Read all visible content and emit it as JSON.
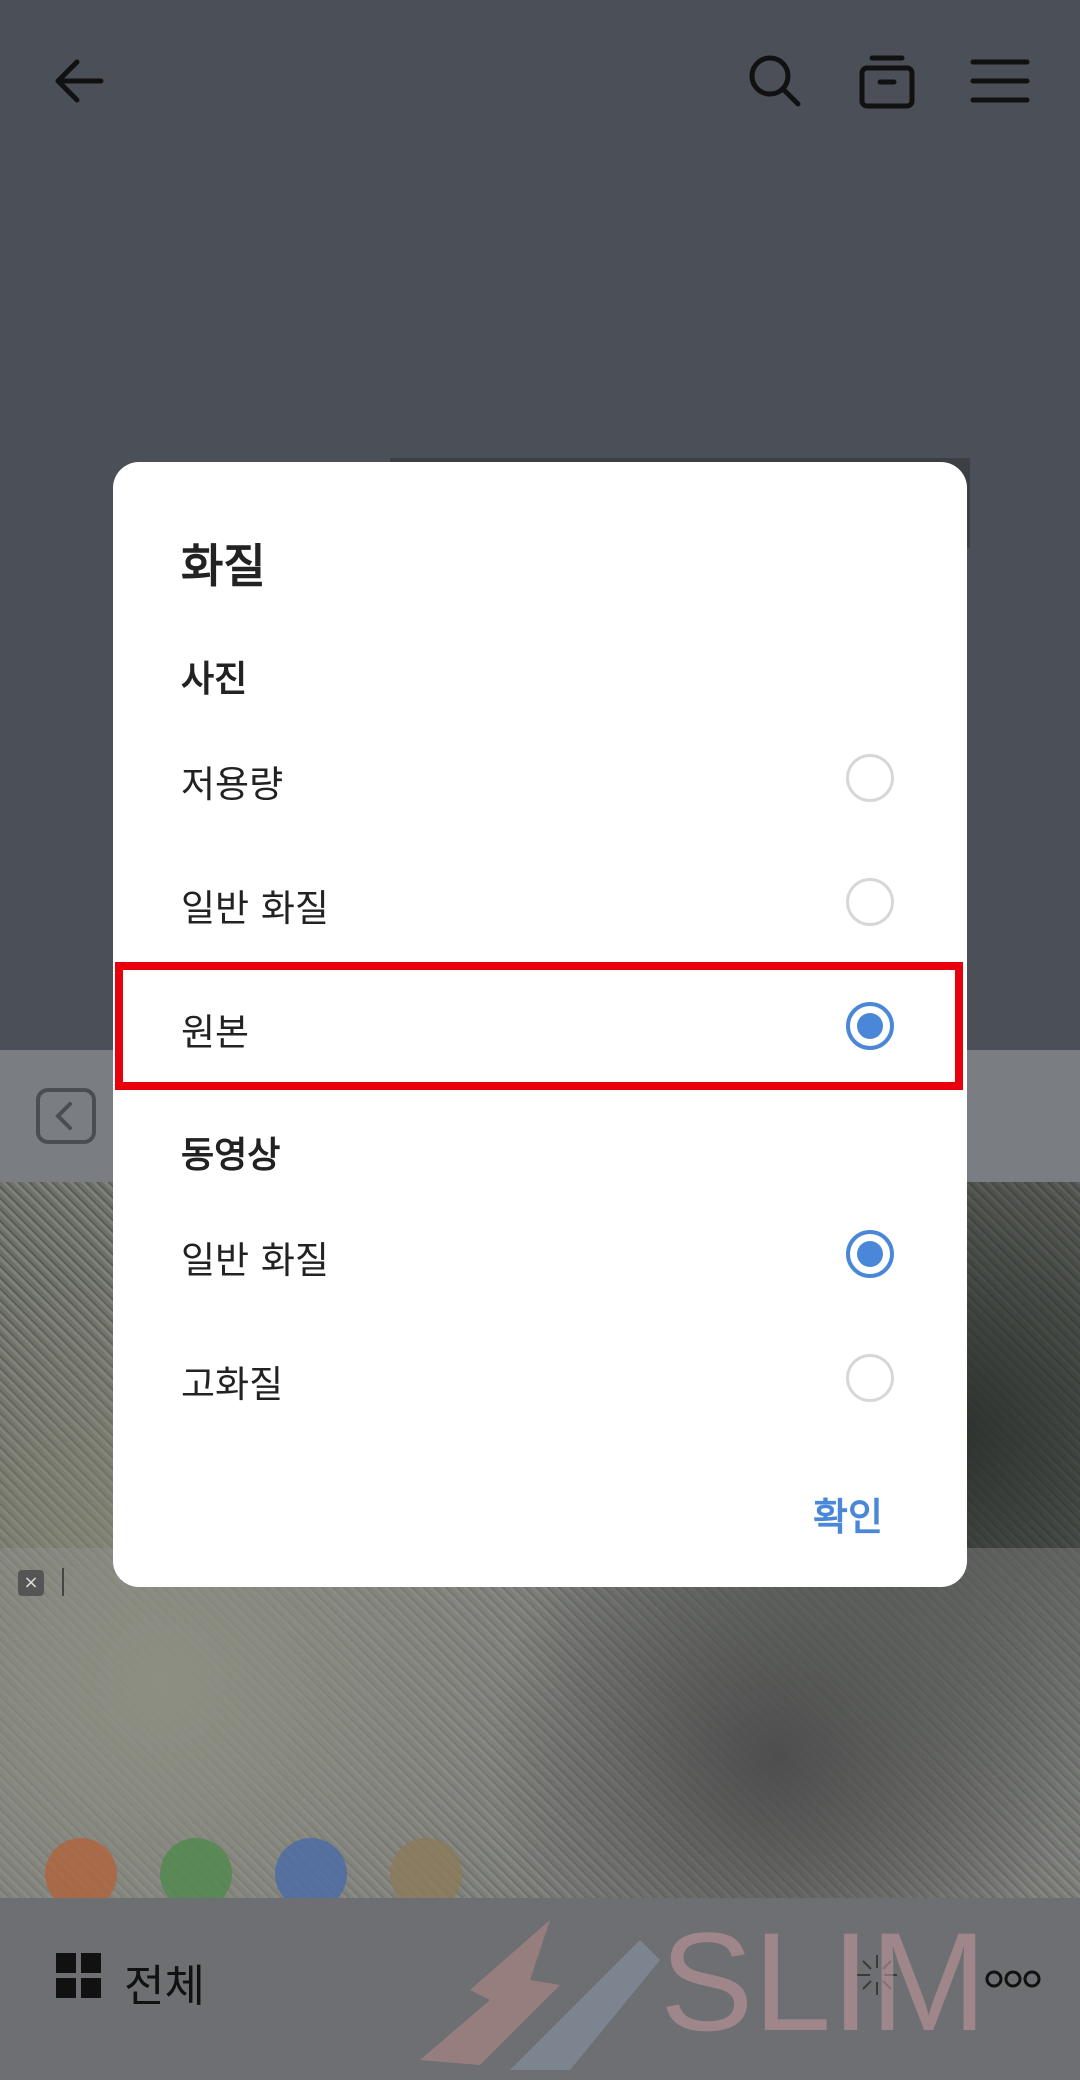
{
  "dialog": {
    "title": "화질",
    "photo_section": "사진",
    "photo_options": [
      {
        "label": "저용량",
        "selected": false
      },
      {
        "label": "일반 화질",
        "selected": false
      },
      {
        "label": "원본",
        "selected": true
      }
    ],
    "video_section": "동영상",
    "video_options": [
      {
        "label": "일반 화질",
        "selected": true
      },
      {
        "label": "고화질",
        "selected": false
      }
    ],
    "confirm": "확인"
  },
  "bottom_bar": {
    "label": "전체"
  },
  "watermark": "SLIM",
  "colors": {
    "accent": "#4a87d8",
    "highlight": "#e8000c"
  },
  "icons": [
    "back-arrow-icon",
    "search-icon",
    "archive-icon",
    "menu-icon",
    "back-chevron-icon",
    "close-icon",
    "grid-icon",
    "sparkle-icon",
    "more-icon"
  ]
}
